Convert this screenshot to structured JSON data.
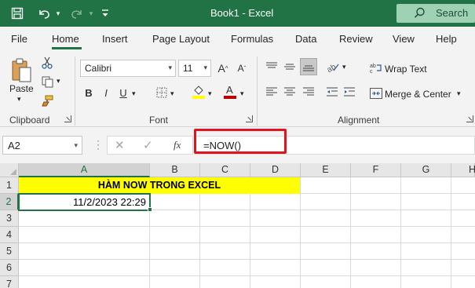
{
  "title": {
    "app_title": "Book1  -  Excel",
    "search_label": "Search"
  },
  "tabs": [
    "File",
    "Home",
    "Insert",
    "Page Layout",
    "Formulas",
    "Data",
    "Review",
    "View",
    "Help"
  ],
  "ribbon": {
    "paste_label": "Paste",
    "clipboard_label": "Clipboard",
    "font_name": "Calibri",
    "font_size": "11",
    "font_label": "Font",
    "bold": "B",
    "italic": "I",
    "underline": "U",
    "wrap_text": "Wrap Text",
    "merge_center": "Merge & Center",
    "alignment_label": "Alignment",
    "highlight_color": "#ffff00",
    "font_color": "#c00000"
  },
  "formula_bar": {
    "name_box": "A2",
    "fx_symbol": "fx",
    "formula": "=NOW()"
  },
  "sheet": {
    "columns": [
      "A",
      "B",
      "C",
      "D",
      "E",
      "F",
      "G",
      "H"
    ],
    "rows": [
      "1",
      "2",
      "3",
      "4",
      "5",
      "6",
      "7"
    ],
    "a1_text": "HÀM NOW TRONG EXCEL",
    "a2_value": "11/2/2023 22:29",
    "selected_cell": "A2"
  },
  "colors": {
    "accent": "#217346",
    "title_fill": "#ffff00",
    "annotation_box": "#e0141e"
  }
}
